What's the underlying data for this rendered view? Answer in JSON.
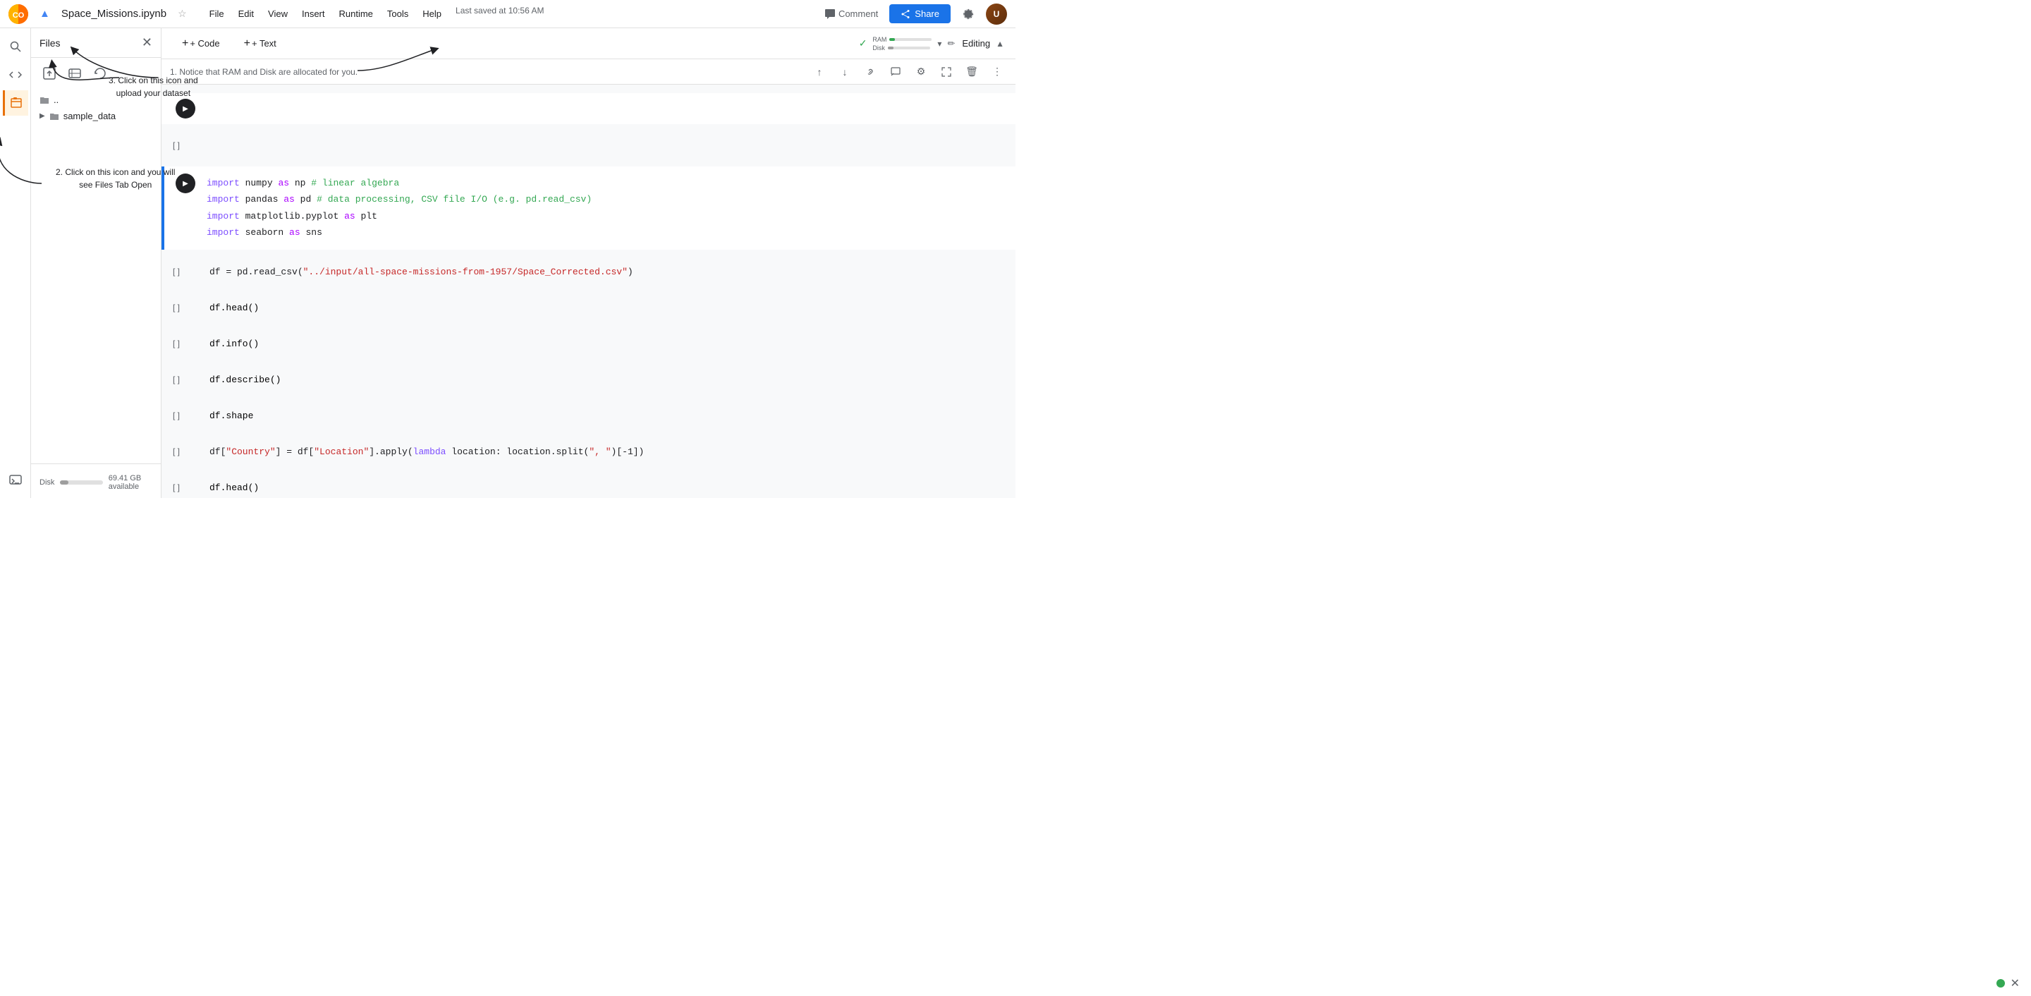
{
  "topbar": {
    "logo_text": "CO",
    "file_name": "Space_Missions.ipynb",
    "star_label": "☆",
    "menu_items": [
      "File",
      "Edit",
      "View",
      "Insert",
      "Runtime",
      "Tools",
      "Help"
    ],
    "last_saved": "Last saved at 10:56 AM",
    "comment_label": "Comment",
    "share_label": "Share",
    "settings_icon": "⚙",
    "drive_icon": "▲"
  },
  "toolbar": {
    "code_label": "+ Code",
    "text_label": "+ Text",
    "editing_label": "Editing",
    "ram_label": "RAM",
    "disk_label": "Disk"
  },
  "sidebar": {
    "title": "Files",
    "close_icon": "✕",
    "parent_folder": "..",
    "sample_data": "sample_data",
    "disk_label": "Disk",
    "disk_available": "69.41 GB available"
  },
  "notice": {
    "text": "1. Notice that RAM and Disk are allocated for you."
  },
  "annotations": {
    "ann1": "2. Click on this icon and you will\nsee Files Tab Open",
    "ann2": "3. Click on this icon and\nupload your dataset"
  },
  "cells": [
    {
      "id": "cell-play",
      "type": "text",
      "has_play": true,
      "content": ""
    },
    {
      "id": "cell-empty1",
      "type": "code",
      "bracket": "[ ]",
      "content": ""
    },
    {
      "id": "cell-imports",
      "type": "code",
      "bracket": "",
      "has_play": true,
      "lines": [
        {
          "tokens": [
            {
              "t": "import",
              "c": "kw"
            },
            {
              "t": " numpy ",
              "c": "lib"
            },
            {
              "t": "as",
              "c": "kw2"
            },
            {
              "t": " np ",
              "c": "lib"
            },
            {
              "t": "# linear algebra",
              "c": "comment"
            }
          ]
        },
        {
          "tokens": [
            {
              "t": "import",
              "c": "kw"
            },
            {
              "t": " pandas ",
              "c": "lib"
            },
            {
              "t": "as",
              "c": "kw2"
            },
            {
              "t": " pd ",
              "c": "lib"
            },
            {
              "t": "# data processing, CSV file I/O (e.g. pd.read_csv)",
              "c": "comment"
            }
          ]
        },
        {
          "tokens": [
            {
              "t": "import",
              "c": "kw"
            },
            {
              "t": " matplotlib.pyplot ",
              "c": "lib"
            },
            {
              "t": "as",
              "c": "kw2"
            },
            {
              "t": " plt",
              "c": "lib"
            }
          ]
        },
        {
          "tokens": [
            {
              "t": "import",
              "c": "kw"
            },
            {
              "t": " seaborn ",
              "c": "lib"
            },
            {
              "t": "as",
              "c": "kw2"
            },
            {
              "t": " sns",
              "c": "lib"
            }
          ]
        }
      ]
    },
    {
      "id": "cell-read-csv",
      "type": "code",
      "bracket": "[ ]",
      "content": "df = pd.read_csv(\"../input/all-space-missions-from-1957/Space_Corrected.csv\")"
    },
    {
      "id": "cell-head1",
      "type": "code",
      "bracket": "[ ]",
      "content": "df.head()"
    },
    {
      "id": "cell-info",
      "type": "code",
      "bracket": "[ ]",
      "content": "df.info()"
    },
    {
      "id": "cell-describe",
      "type": "code",
      "bracket": "[ ]",
      "content": "df.describe()"
    },
    {
      "id": "cell-shape",
      "type": "code",
      "bracket": "[ ]",
      "content": "df.shape"
    },
    {
      "id": "cell-country",
      "type": "code",
      "bracket": "[ ]",
      "content_parts": [
        {
          "t": "df[",
          "c": "op"
        },
        {
          "t": "\"Country\"",
          "c": "key"
        },
        {
          "t": "] = df[",
          "c": "op"
        },
        {
          "t": "\"Location\"",
          "c": "key"
        },
        {
          "t": "].apply(",
          "c": "op"
        },
        {
          "t": "lambda",
          "c": "kw"
        },
        {
          "t": " location: location.split(",
          "c": "lib"
        },
        {
          "t": "\", \"",
          "c": "string"
        },
        {
          "t": ")[-1])",
          "c": "op"
        }
      ]
    },
    {
      "id": "cell-head2",
      "type": "code",
      "bracket": "[ ]",
      "content": "df.head()"
    }
  ],
  "cell_toolbar_buttons": [
    "↑",
    "↓",
    "🔗",
    "□",
    "⚙",
    "⎋",
    "🗑",
    "⋮"
  ],
  "status": {
    "dot_color": "#34A853",
    "close_label": "✕"
  }
}
